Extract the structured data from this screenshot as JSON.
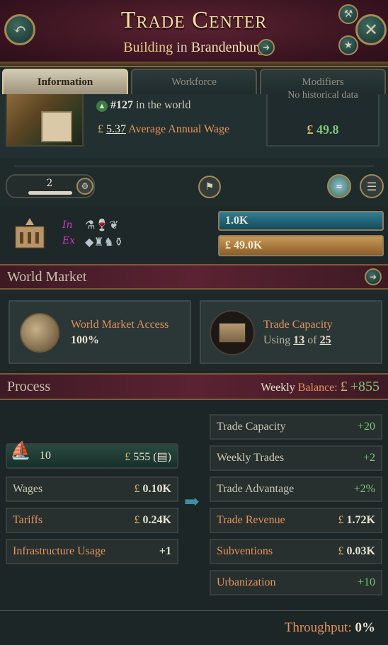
{
  "header": {
    "title": "Trade Center",
    "subtitle_prefix": "Building",
    "subtitle_in": "in",
    "subtitle_location": "Brandenburg"
  },
  "tabs": [
    {
      "label": "Information",
      "active": true
    },
    {
      "label": "Workforce",
      "active": false
    },
    {
      "label": "Modifiers",
      "active": false
    }
  ],
  "info": {
    "rank_text": "#127",
    "rank_suffix": "in the world",
    "wage_value": "5.37",
    "wage_label": "Average Annual Wage",
    "historical_text": "No historical data",
    "history_value": "49.8"
  },
  "controls": {
    "level_value": "2"
  },
  "products": {
    "labels": [
      "In",
      "Ex"
    ],
    "bar_blue_value": "1.0K",
    "bar_gold_value": "49.0K"
  },
  "world_market": {
    "title": "World Market",
    "access_title": "World Market Access",
    "access_value": "100%",
    "capacity_title": "Trade Capacity",
    "capacity_using": "Using",
    "capacity_used": "13",
    "capacity_of": "of",
    "capacity_total": "25"
  },
  "process": {
    "title": "Process",
    "weekly_label": "Weekly",
    "balance_label": "Balance:",
    "balance_value": "+855",
    "goods_count": "10",
    "goods_value": "555",
    "left_rows": [
      {
        "label": "Wages",
        "value": "0.10K"
      },
      {
        "label": "Tariffs",
        "value": "0.24K"
      },
      {
        "label": "Infrastructure Usage",
        "value": "+1"
      }
    ],
    "right_rows": [
      {
        "label": "Trade Capacity",
        "value": "+20"
      },
      {
        "label": "Weekly Trades",
        "value": "+2"
      },
      {
        "label": "Trade Advantage",
        "value": "+2%"
      },
      {
        "label": "Trade Revenue",
        "value": "1.72K"
      },
      {
        "label": "Subventions",
        "value": "0.03K"
      },
      {
        "label": "Urbanization",
        "value": "+10"
      }
    ],
    "throughput_label": "Throughput:",
    "throughput_value": "0%"
  },
  "currency_symbol": "£",
  "colors": {
    "header_bg": "#4a1a29",
    "gold_text": "#f4dd9f",
    "orange_label": "#e8925a",
    "green_value": "#7fc57b",
    "bar_blue": "#1f5f73",
    "bar_gold": "#b07a3a"
  }
}
